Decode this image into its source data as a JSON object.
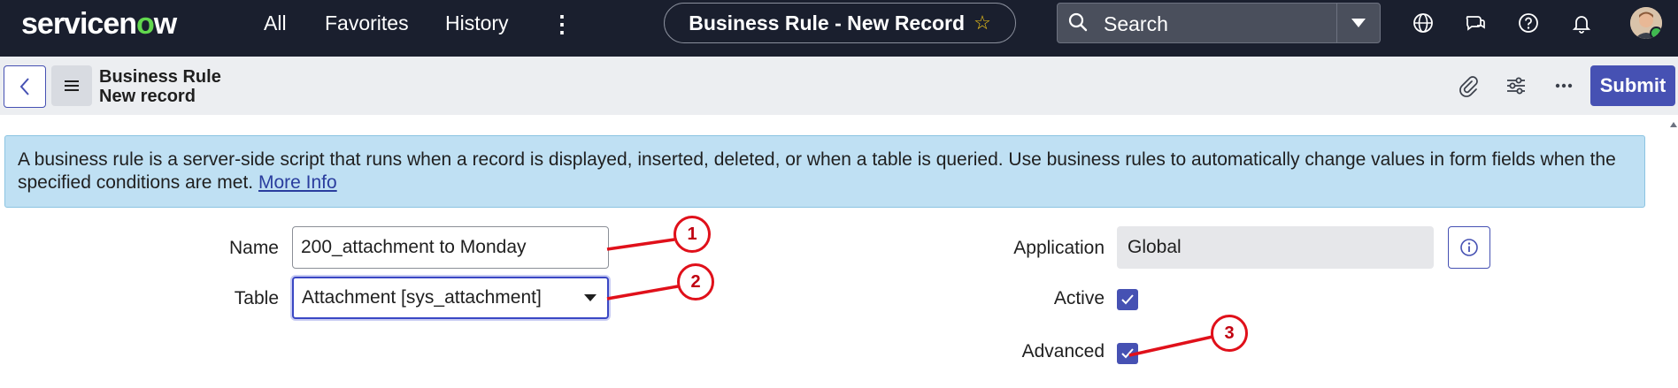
{
  "brand": {
    "logo_text_before": "servicen",
    "logo_o": "o",
    "logo_text_after": "w",
    "accent_color": "#62d84e"
  },
  "nav": {
    "all": "All",
    "favorites": "Favorites",
    "history": "History",
    "more": "⋮"
  },
  "record_title": "Business Rule - New Record",
  "search": {
    "placeholder": "Search"
  },
  "top_icons": [
    "globe-icon",
    "chat-icon",
    "help-icon",
    "bell-icon",
    "avatar"
  ],
  "form_header": {
    "line1": "Business Rule",
    "line2": "New record",
    "submit_label": "Submit"
  },
  "form_header_icons": [
    "paperclip-icon",
    "sliders-icon",
    "more-icon"
  ],
  "banner": {
    "text": "A business rule is a server-side script that runs when a record is displayed, inserted, deleted, or when a table is queried. Use business rules to automatically change values in form fields when the specified conditions are met.",
    "link": "More Info"
  },
  "fields": {
    "name": {
      "label": "Name",
      "value": "200_attachment to Monday"
    },
    "table": {
      "label": "Table",
      "value": "Attachment [sys_attachment]"
    },
    "application": {
      "label": "Application",
      "value": "Global"
    },
    "active": {
      "label": "Active",
      "checked": true
    },
    "advanced": {
      "label": "Advanced",
      "checked": true
    }
  },
  "annotations": [
    "1",
    "2",
    "3"
  ],
  "colors": {
    "primary": "#4651b3",
    "topbar": "#1a1f2e",
    "banner": "#bfe0f3",
    "annotation": "#e0101a"
  }
}
